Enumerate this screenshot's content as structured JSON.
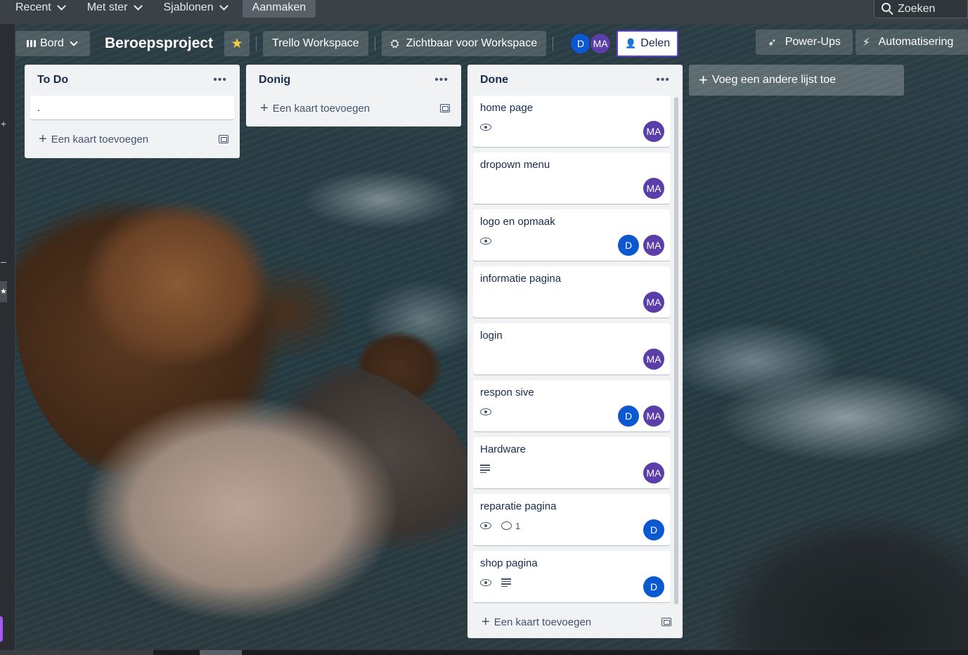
{
  "topnav": {
    "items": [
      {
        "label": "Recent"
      },
      {
        "label": "Met ster"
      },
      {
        "label": "Sjablonen"
      }
    ],
    "create_label": "Aanmaken",
    "search_placeholder": "Zoeken"
  },
  "board": {
    "view_label": "Bord",
    "title": "Beroepsproject",
    "workspace_label": "Trello Workspace",
    "visibility_label": "Zichtbaar voor Workspace",
    "members": [
      "D",
      "MA"
    ],
    "share_label": "Delen",
    "powerups_label": "Power-Ups",
    "automation_label": "Automatisering",
    "add_list_label": "Voeg een andere lijst toe"
  },
  "lists": [
    {
      "title": "To Do",
      "cards": [
        {
          "title": "."
        }
      ],
      "add_label": "Een kaart toevoegen"
    },
    {
      "title": "Donig",
      "cards": [],
      "add_label": "Een kaart toevoegen"
    },
    {
      "title": "Done",
      "add_label": "Een kaart toevoegen",
      "cards": [
        {
          "title": "home page",
          "badges": {
            "watch": true
          },
          "members": [
            "MA"
          ]
        },
        {
          "title": "dropown menu",
          "members": [
            "MA"
          ]
        },
        {
          "title": "logo en opmaak",
          "badges": {
            "watch": true
          },
          "members": [
            "D",
            "MA"
          ]
        },
        {
          "title": "informatie pagina",
          "members": [
            "MA"
          ]
        },
        {
          "title": "login",
          "members": [
            "MA"
          ]
        },
        {
          "title": "respon sive",
          "badges": {
            "watch": true
          },
          "members": [
            "D",
            "MA"
          ]
        },
        {
          "title": "Hardware",
          "badges": {
            "description": true
          },
          "members": [
            "MA"
          ]
        },
        {
          "title": "reparatie pagina",
          "badges": {
            "watch": true,
            "comments": "1"
          },
          "members": [
            "D"
          ]
        },
        {
          "title": "shop pagina",
          "badges": {
            "watch": true,
            "description": true
          },
          "members": [
            "D"
          ]
        }
      ]
    }
  ],
  "colors": {
    "avatar_d": "#0c58d0",
    "avatar_ma": "#5a3fa8",
    "star": "#f5cd47",
    "share_border": "#5a3fe0"
  }
}
